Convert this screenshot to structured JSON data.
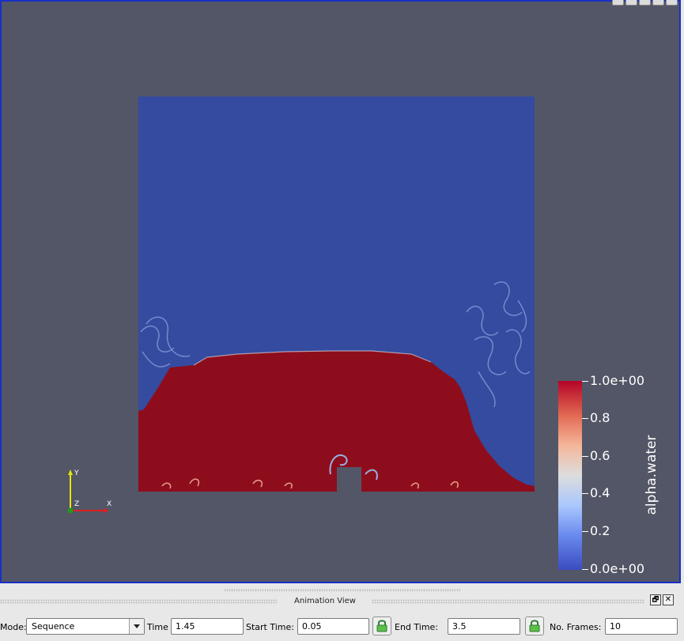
{
  "viewport": {
    "background": "#535666",
    "border_color": "#1a2fc4",
    "water_color": "#8e0d1c",
    "air_color": "#344ba0",
    "obstacle_color": "#535666"
  },
  "legend": {
    "title": "alpha.water",
    "ticks": [
      "1.0e+00",
      "0.8",
      "0.6",
      "0.4",
      "0.2",
      "0.0e+00"
    ],
    "colormap": "cool-to-warm",
    "range": [
      0.0,
      1.0
    ]
  },
  "axes": {
    "y": "Y",
    "z": "Z",
    "x": "X"
  },
  "animation_panel": {
    "title": "Animation View",
    "restore_icon": "restore-icon",
    "close_icon": "close-icon",
    "close_glyph": "✕",
    "restore_glyph": "🗗",
    "mode_label": "Mode:",
    "mode_value": "Sequence",
    "time_label": "Time",
    "time_value": "1.45",
    "start_time_label": "Start Time:",
    "start_time_value": "0.05",
    "end_time_label": "End Time:",
    "end_time_value": "3.5",
    "frames_label": "No. Frames:",
    "frames_value": "10",
    "lock_icon": "lock-icon"
  }
}
